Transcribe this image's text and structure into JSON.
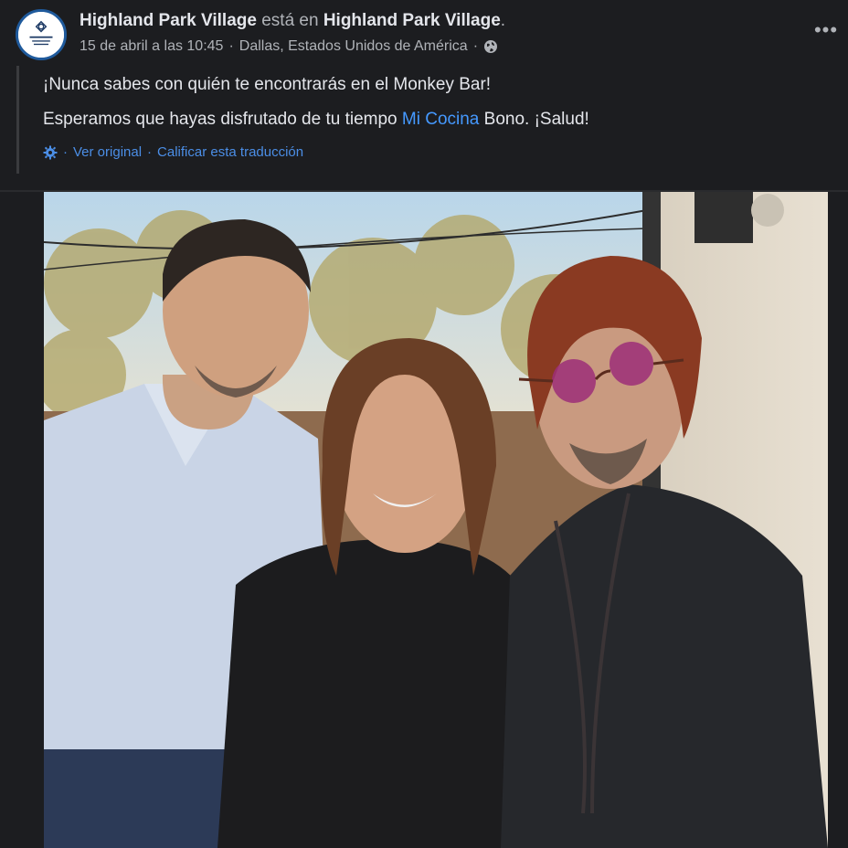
{
  "post": {
    "author": "Highland Park Village",
    "verb": "está en",
    "location": "Highland Park Village",
    "period": ".",
    "date": "15 de abril a las 10:45",
    "separator": "·",
    "place": "Dallas, Estados Unidos de América",
    "privacy_icon": "globe-icon",
    "more_icon": "more-options-icon",
    "more_label": "•••"
  },
  "content": {
    "line1": "¡Nunca sabes con quién te encontrarás en el Monkey Bar!",
    "line2_before": "Esperamos que hayas disfrutado de tu tiempo ",
    "line2_mention": "Mi Cocina",
    "line2_after": " Bono. ¡Salud!"
  },
  "translation": {
    "icon": "gear-icon",
    "view_original": "Ver original",
    "separator": "·",
    "rate": "Calificar esta traducción"
  },
  "colors": {
    "background": "#1c1d20",
    "text": "#e4e6eb",
    "muted": "#b0b3b8",
    "link": "#4599ff"
  }
}
